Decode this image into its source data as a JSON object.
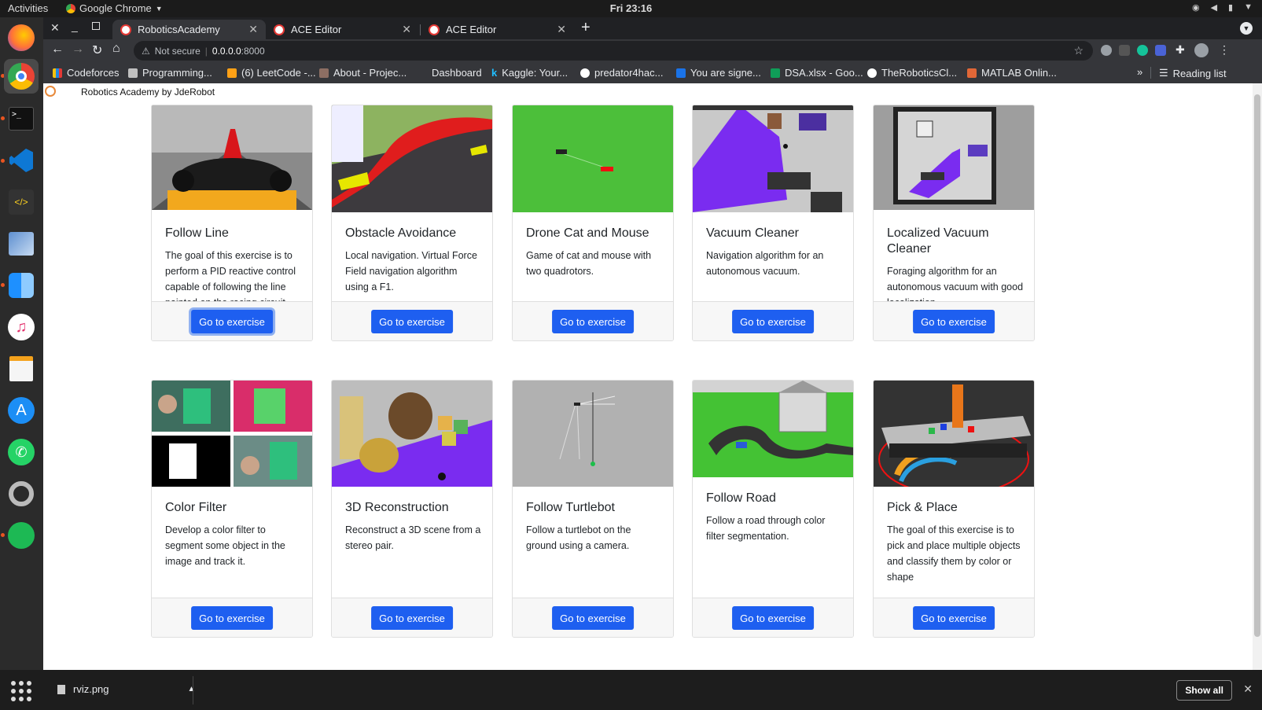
{
  "os": {
    "activities": "Activities",
    "app_name": "Google Chrome",
    "clock": "Fri 23:16"
  },
  "tabs": [
    {
      "label": "RoboticsAcademy",
      "active": true
    },
    {
      "label": "ACE Editor",
      "active": false
    },
    {
      "label": "ACE Editor",
      "active": false
    }
  ],
  "address": {
    "security": "Not secure",
    "url": "0.0.0.0",
    "port": ":8000"
  },
  "bookmarks": [
    {
      "label": "Codeforces",
      "color": "#f4c20d"
    },
    {
      "label": "Programming...",
      "color": "#c0c0c0"
    },
    {
      "label": "(6) LeetCode -...",
      "color": "#ffa116"
    },
    {
      "label": "About - Projec...",
      "color": "#8d6e63"
    },
    {
      "label": "Dashboard",
      "color": "#35363a"
    },
    {
      "label": "Kaggle: Your...",
      "color": "#20beff"
    },
    {
      "label": "predator4hac...",
      "color": "#ffffff"
    },
    {
      "label": "You are signe...",
      "color": "#1a73e8"
    },
    {
      "label": "DSA.xlsx - Goo...",
      "color": "#0f9d58"
    },
    {
      "label": "TheRoboticsCl...",
      "color": "#ffffff"
    },
    {
      "label": "MATLAB Onlin...",
      "color": "#e16737"
    }
  ],
  "reading_list": "Reading list",
  "page": {
    "brand": "Robotics Academy by JdeRobot",
    "button_label": "Go to exercise",
    "exercises": [
      {
        "title": "Follow Line",
        "description": "The goal of this exercise is to perform a PID reactive control capable of following the line painted on the racing circuit."
      },
      {
        "title": "Obstacle Avoidance",
        "description": "Local navigation. Virtual Force Field navigation algorithm using a F1."
      },
      {
        "title": "Drone Cat and Mouse",
        "description": "Game of cat and mouse with two quadrotors."
      },
      {
        "title": "Vacuum Cleaner",
        "description": "Navigation algorithm for an autonomous vacuum."
      },
      {
        "title": "Localized Vacuum Cleaner",
        "description": "Foraging algorithm for an autonomous vacuum with good localization."
      },
      {
        "title": "Color Filter",
        "description": "Develop a color filter to segment some object in the image and track it."
      },
      {
        "title": "3D Reconstruction",
        "description": "Reconstruct a 3D scene from a stereo pair."
      },
      {
        "title": "Follow Turtlebot",
        "description": "Follow a turtlebot on the ground using a camera."
      },
      {
        "title": "Follow Road",
        "description": "Follow a road through color filter segmentation."
      },
      {
        "title": "Pick & Place",
        "description": "The goal of this exercise is to pick and place multiple objects and classify them by color or shape"
      }
    ]
  },
  "downloads": {
    "file": "rviz.png",
    "show_all": "Show all"
  }
}
